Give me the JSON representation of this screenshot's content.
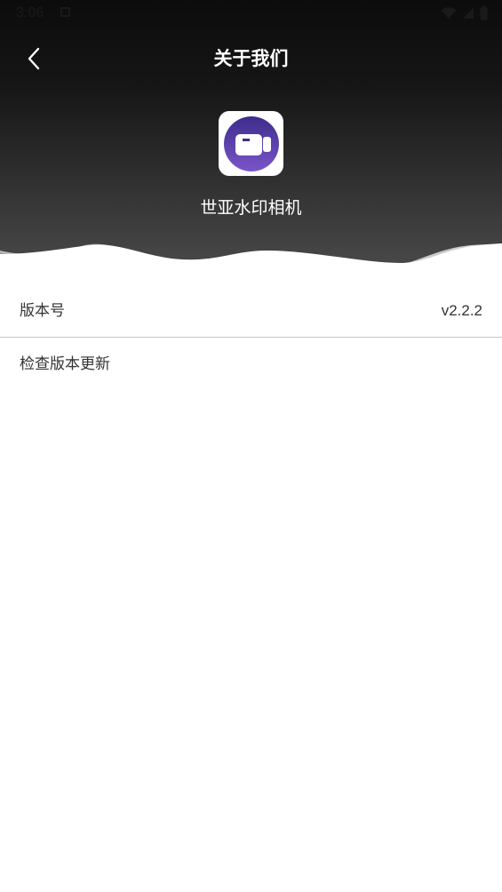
{
  "status_bar": {
    "time": "3:06"
  },
  "header": {
    "title": "关于我们"
  },
  "app": {
    "name": "世亚水印相机"
  },
  "rows": [
    {
      "label": "版本号",
      "value": "v2.2.2"
    },
    {
      "label": "检查版本更新"
    }
  ],
  "colors": {
    "header_top": "#0e0e0e",
    "header_bottom": "#4a4a4a",
    "icon_circle": "#5b3fa8",
    "text": "#333333"
  }
}
